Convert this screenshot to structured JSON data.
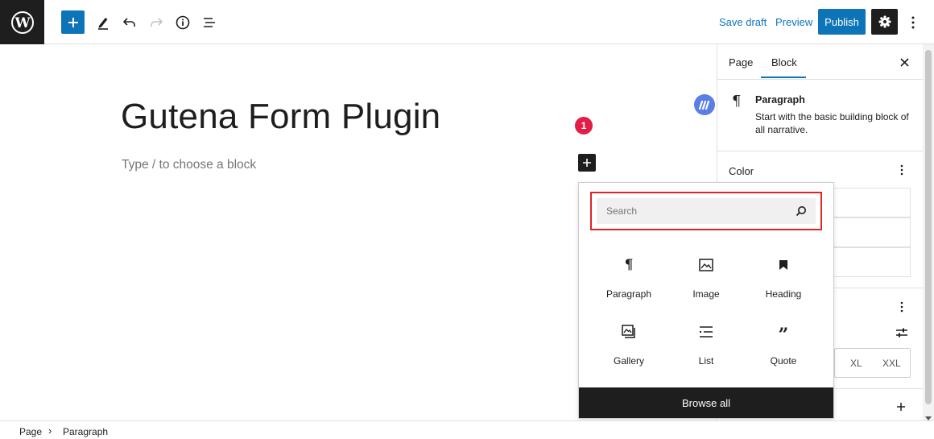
{
  "header": {
    "save_draft": "Save draft",
    "preview": "Preview",
    "publish": "Publish"
  },
  "editor": {
    "title": "Gutena Form Plugin",
    "placeholder": "Type / to choose a block",
    "notification_count": "1"
  },
  "inserter": {
    "search_placeholder": "Search",
    "blocks": [
      {
        "label": "Paragraph",
        "icon": "paragraph-icon"
      },
      {
        "label": "Image",
        "icon": "image-icon"
      },
      {
        "label": "Heading",
        "icon": "heading-icon"
      },
      {
        "label": "Gallery",
        "icon": "gallery-icon"
      },
      {
        "label": "List",
        "icon": "list-icon"
      },
      {
        "label": "Quote",
        "icon": "quote-icon"
      }
    ],
    "browse_all": "Browse all"
  },
  "sidebar": {
    "tabs": [
      "Page",
      "Block"
    ],
    "active_tab": "Block",
    "block_card": {
      "title": "Paragraph",
      "description": "Start with the basic building block of all narrative."
    },
    "color_label": "Color",
    "font_sizes": [
      "XL",
      "XXL"
    ]
  },
  "breadcrumb": [
    "Page",
    "Paragraph"
  ],
  "colors": {
    "accent": "#0e74b8",
    "badge": "#e11d48",
    "highlight": "#e02424",
    "dark": "#1e1e1e"
  }
}
